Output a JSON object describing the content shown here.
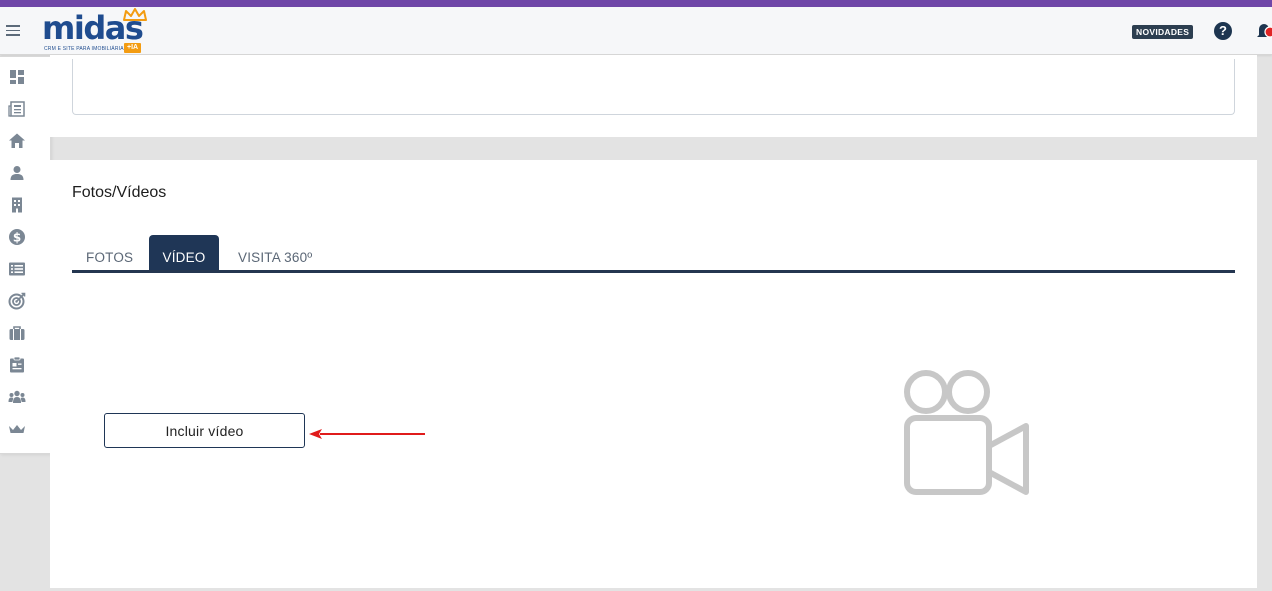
{
  "header": {
    "logo_text": "midas",
    "logo_subtitle": "CRM E SITE PARA IMOBILIÁRIA",
    "logo_badge": "+IA",
    "news_label": "NOVIDADES",
    "help_glyph": "?"
  },
  "sidebar": {
    "items": [
      {
        "icon": "dashboard-icon"
      },
      {
        "icon": "newspaper-icon"
      },
      {
        "icon": "home-icon"
      },
      {
        "icon": "user-icon"
      },
      {
        "icon": "building-icon"
      },
      {
        "icon": "dollar-icon"
      },
      {
        "icon": "list-icon"
      },
      {
        "icon": "target-icon"
      },
      {
        "icon": "briefcase-icon"
      },
      {
        "icon": "clipboard-icon"
      },
      {
        "icon": "team-icon"
      },
      {
        "icon": "crown-icon"
      }
    ]
  },
  "media": {
    "title": "Fotos/Vídeos",
    "tabs": [
      {
        "label": "FOTOS",
        "active": false
      },
      {
        "label": "VÍDEO",
        "active": true
      },
      {
        "label": "VISITA 360º",
        "active": false
      }
    ],
    "include_video_label": "Incluir vídeo",
    "placeholder_icon": "video-camera-icon"
  },
  "colors": {
    "top_stripe": "#6f46a8",
    "brand_blue": "#1f4c8f",
    "active_tab": "#1f3656",
    "arrow": "#e01b1b",
    "badge_orange": "#f39c12"
  }
}
